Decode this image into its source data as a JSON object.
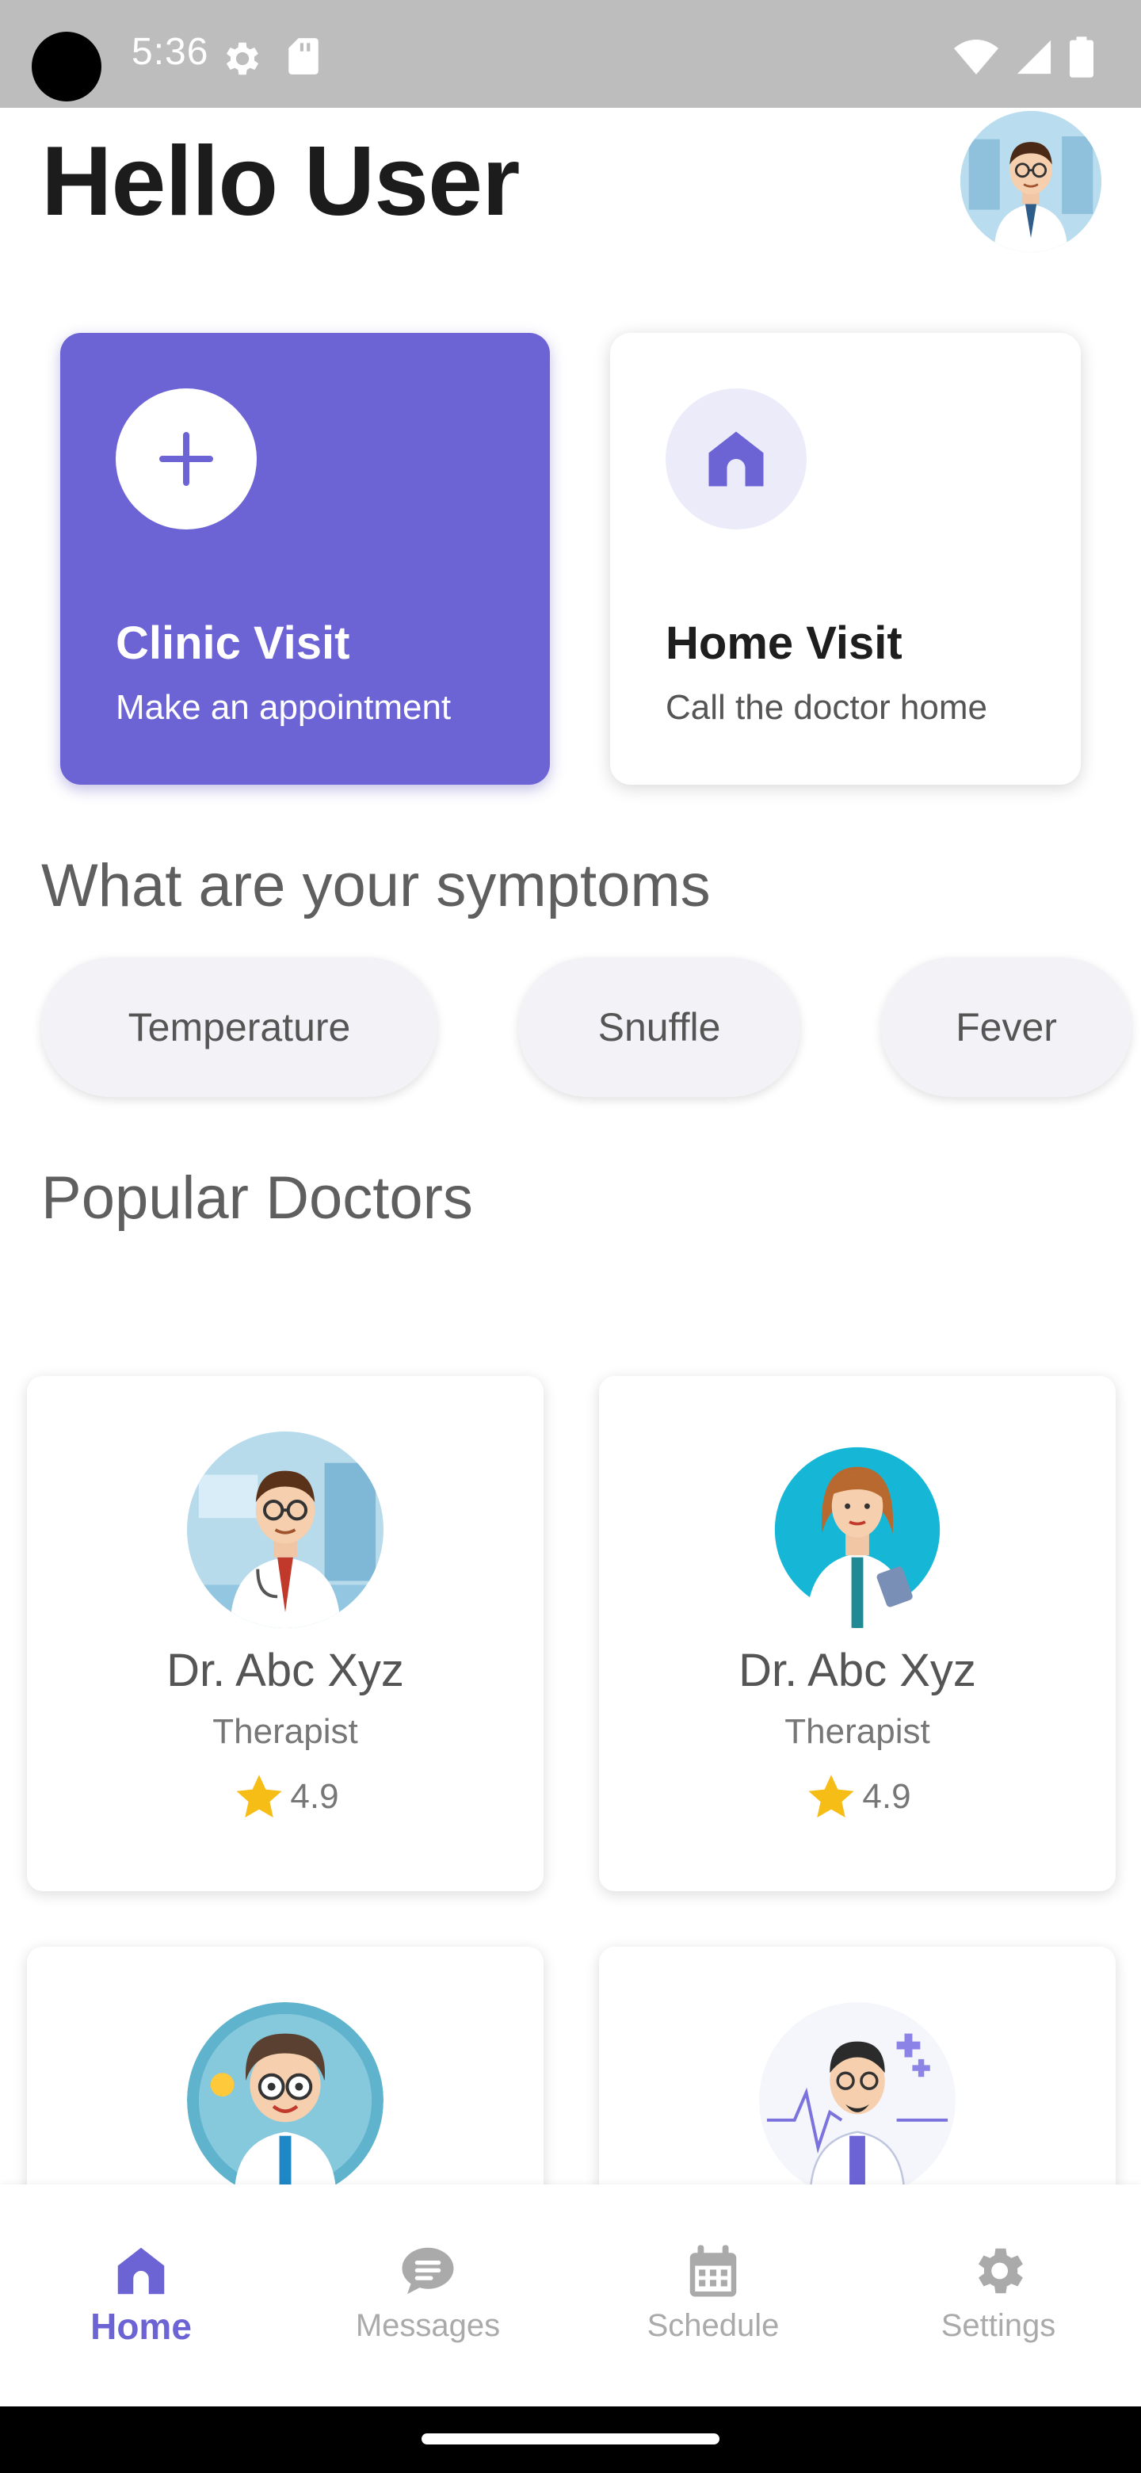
{
  "status_bar": {
    "time": "5:36",
    "icons": [
      "gear-icon",
      "sd-card-icon",
      "wifi-icon",
      "signal-icon",
      "battery-icon"
    ]
  },
  "header": {
    "greeting": "Hello User",
    "avatar": "doctor-avatar"
  },
  "visit_options": [
    {
      "title": "Clinic Visit",
      "subtitle": "Make an appointment",
      "icon": "plus-icon",
      "selected": true
    },
    {
      "title": "Home Visit",
      "subtitle": "Call the doctor home",
      "icon": "home-icon",
      "selected": false
    }
  ],
  "symptoms": {
    "title": "What are your symptoms",
    "chips": [
      "Temperature",
      "Snuffle",
      "Fever"
    ]
  },
  "doctors": {
    "title": "Popular Doctors",
    "cards": [
      {
        "name": "Dr. Abc Xyz",
        "specialty": "Therapist",
        "rating": "4.9"
      },
      {
        "name": "Dr. Abc Xyz",
        "specialty": "Therapist",
        "rating": "4.9"
      },
      {
        "name": "",
        "specialty": "",
        "rating": ""
      },
      {
        "name": "",
        "specialty": "",
        "rating": ""
      }
    ]
  },
  "bottom_nav": {
    "items": [
      {
        "label": "Home",
        "icon": "home-icon",
        "active": true
      },
      {
        "label": "Messages",
        "icon": "chat-icon",
        "active": false
      },
      {
        "label": "Schedule",
        "icon": "calendar-icon",
        "active": false
      },
      {
        "label": "Settings",
        "icon": "gear-icon",
        "active": false
      }
    ]
  },
  "colors": {
    "accent": "#6c63d5",
    "accent_light": "#ecebfa",
    "chip_bg": "#f3f3f7",
    "star": "#f6bd16",
    "inactive": "#aaaaaa"
  }
}
